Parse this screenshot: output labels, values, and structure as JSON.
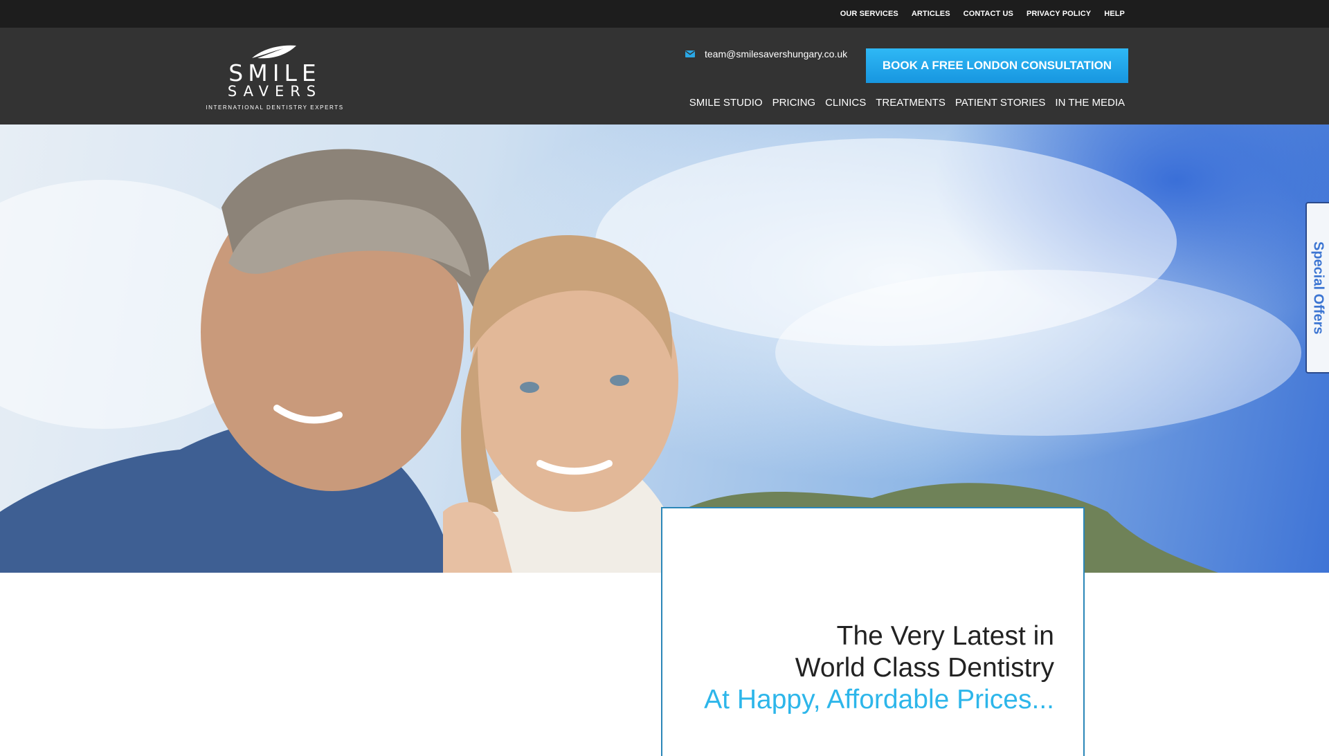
{
  "topbar": {
    "links": [
      "OUR SERVICES",
      "ARTICLES",
      "CONTACT US",
      "PRIVACY POLICY",
      "HELP"
    ]
  },
  "header": {
    "logo": {
      "line1": "SMILE",
      "line2": "SAVERS",
      "tagline": "INTERNATIONAL DENTISTRY EXPERTS"
    },
    "email": "team@smilesavershungary.co.uk",
    "cta_label": "BOOK A FREE LONDON CONSULTATION",
    "nav": [
      "SMILE STUDIO",
      "PRICING",
      "CLINICS",
      "TREATMENTS",
      "PATIENT STORIES",
      "IN THE MEDIA"
    ]
  },
  "side_tab": {
    "label": "Special Offers"
  },
  "hero_card": {
    "line1": "The Very Latest in",
    "line2": "World Class Dentistry",
    "accent": "At Happy, Affordable Prices..."
  },
  "colors": {
    "topbar_bg": "#1d1d1d",
    "header_bg": "#333333",
    "cta_bg": "#1fa6ec",
    "accent_text": "#2db6ea",
    "card_border": "#2a86b8",
    "offers_text": "#3c75d2"
  },
  "icons": {
    "email": "envelope-icon",
    "logo": "leaf-icon"
  }
}
